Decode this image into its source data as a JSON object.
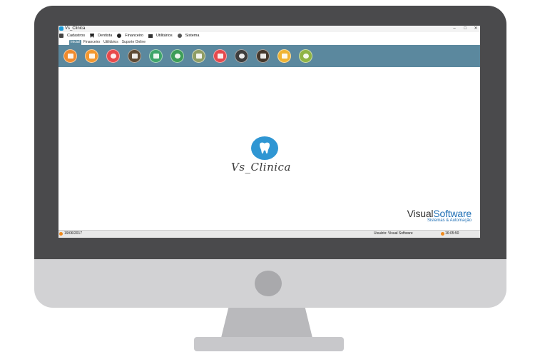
{
  "window": {
    "title": "Vs_Clinica",
    "controls": [
      "–",
      "□",
      "✕"
    ]
  },
  "menu": {
    "items": [
      {
        "label": "Cadastros",
        "icon": "clipboard-icon"
      },
      {
        "label": "Dentista",
        "icon": "tooth-icon"
      },
      {
        "label": "Financeiro",
        "icon": "dollar-icon"
      },
      {
        "label": "Utilitários",
        "icon": "folder-icon"
      },
      {
        "label": "Sistema",
        "icon": "gear-icon"
      }
    ]
  },
  "ribbon": {
    "tabs": [
      "Inicial",
      "Financeiro",
      "Utilitários",
      "Suporte Online"
    ],
    "active_tab": "Inicial"
  },
  "toolbar": {
    "buttons": [
      {
        "icon": "patients-icon",
        "color": "#f08a2c"
      },
      {
        "icon": "dentist-icon",
        "color": "#f2972e"
      },
      {
        "icon": "globe-icon",
        "color": "#e8484a"
      },
      {
        "icon": "agenda-icon",
        "color": "#5e4a34"
      },
      {
        "icon": "wallet-icon",
        "color": "#3ea56a"
      },
      {
        "icon": "money-bag-icon",
        "color": "#3c9d57"
      },
      {
        "icon": "card-icon",
        "color": "#8f9d64"
      },
      {
        "icon": "report-icon",
        "color": "#e5484c"
      },
      {
        "icon": "add-icon",
        "color": "#3d3d3d"
      },
      {
        "icon": "exit-icon",
        "color": "#43372c"
      },
      {
        "icon": "bulb-icon",
        "color": "#f0b433"
      },
      {
        "icon": "backup-icon",
        "color": "#8fb444"
      }
    ]
  },
  "content": {
    "logo_text": "Vs_Clinica",
    "vendor_part1": "Visual",
    "vendor_part2": "Software",
    "vendor_tagline": "Sistemas & Automação"
  },
  "status": {
    "date": "19/06/2017",
    "user": "Usuário: Visual Software",
    "time": "16:05:50"
  },
  "colors": {
    "accent": "#5b889e",
    "brand_blue": "#2f96d3",
    "status_orange": "#f08a1d"
  }
}
